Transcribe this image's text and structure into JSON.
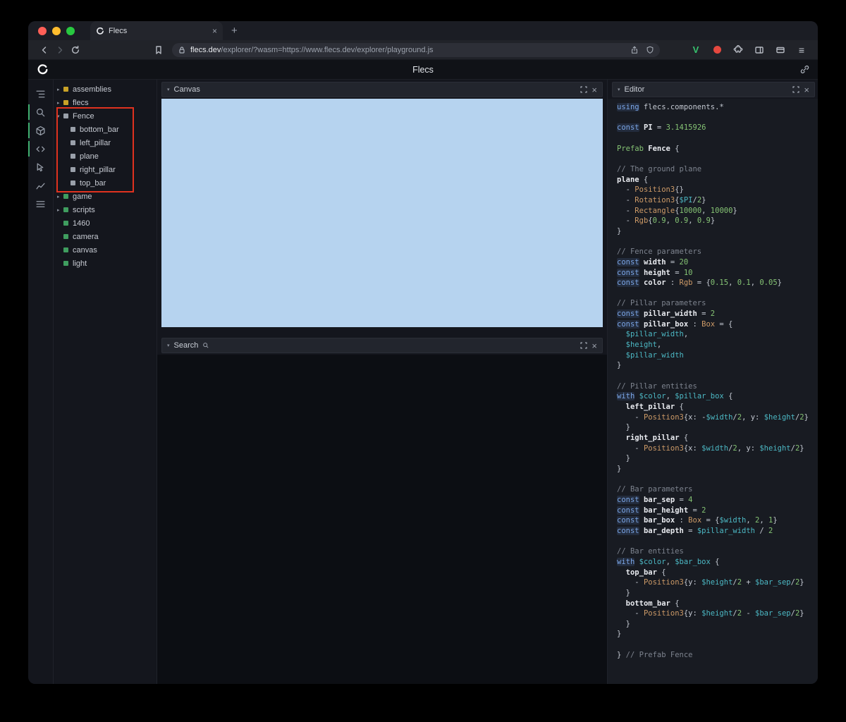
{
  "glyphs": {
    "close": "×",
    "chevron_down": "▾",
    "chevron_right": "▸",
    "new_tab": "+",
    "menu": "≡",
    "v_badge": "V"
  },
  "browser": {
    "tab_title": "Flecs",
    "url_host": "flecs.dev",
    "url_rest": "/explorer/?wasm=https://www.flecs.dev/explorer/playground.js"
  },
  "app": {
    "title": "Flecs"
  },
  "left_toolbar": {
    "items": [
      {
        "icon": "outline-icon",
        "active": false
      },
      {
        "icon": "search-icon",
        "active": true
      },
      {
        "icon": "cube-icon",
        "active": true
      },
      {
        "icon": "code-icon",
        "active": true
      },
      {
        "icon": "select-icon",
        "active": false
      },
      {
        "icon": "chart-icon",
        "active": false
      },
      {
        "icon": "stats-icon",
        "active": false
      }
    ]
  },
  "tree": {
    "items": [
      {
        "label": "assemblies",
        "square": "yellow",
        "expander": "collapsed",
        "depth": 0
      },
      {
        "label": "flecs",
        "square": "yellow",
        "expander": "collapsed",
        "depth": 0
      },
      {
        "label": "Fence",
        "square": "gray",
        "expander": "expanded",
        "depth": 0
      },
      {
        "label": "bottom_bar",
        "square": "gray",
        "expander": "none",
        "depth": 1
      },
      {
        "label": "left_pillar",
        "square": "gray",
        "expander": "none",
        "depth": 1
      },
      {
        "label": "plane",
        "square": "gray",
        "expander": "none",
        "depth": 1
      },
      {
        "label": "right_pillar",
        "square": "gray",
        "expander": "none",
        "depth": 1
      },
      {
        "label": "top_bar",
        "square": "gray",
        "expander": "none",
        "depth": 1
      },
      {
        "label": "game",
        "square": "green",
        "expander": "collapsed",
        "depth": 0
      },
      {
        "label": "scripts",
        "square": "green",
        "expander": "collapsed",
        "depth": 0
      },
      {
        "label": "1460",
        "square": "green",
        "expander": "none",
        "depth": 0
      },
      {
        "label": "camera",
        "square": "green",
        "expander": "none",
        "depth": 0
      },
      {
        "label": "canvas",
        "square": "green",
        "expander": "none",
        "depth": 0
      },
      {
        "label": "light",
        "square": "green",
        "expander": "none",
        "depth": 0
      }
    ]
  },
  "panels": {
    "canvas": {
      "title": "Canvas"
    },
    "search": {
      "title": "Search"
    },
    "editor": {
      "title": "Editor"
    }
  },
  "colors": {
    "canvas_blue": "#b6d3ef",
    "accent_green": "#3fae6f",
    "annotation_red": "#e0321f",
    "square_yellow": "#c9a227",
    "square_green": "#3f9d5f",
    "square_gray": "#9aa0aa"
  },
  "code": {
    "lines": [
      [
        [
          "using",
          "kw"
        ],
        [
          " flecs.components.*",
          "pl"
        ]
      ],
      [],
      [
        [
          "const",
          "kw"
        ],
        [
          " ",
          "pl"
        ],
        [
          "PI",
          "id"
        ],
        [
          " = ",
          "pl"
        ],
        [
          "3.1415926",
          "num"
        ]
      ],
      [],
      [
        [
          "Prefab",
          "green"
        ],
        [
          " ",
          "pl"
        ],
        [
          "Fence",
          "id"
        ],
        [
          " {",
          "pl"
        ]
      ],
      [],
      [
        [
          "// The ground plane",
          "cm"
        ]
      ],
      [
        [
          "plane",
          "id"
        ],
        [
          " {",
          "pl"
        ]
      ],
      [
        [
          "  - ",
          "pl"
        ],
        [
          "Position3",
          "ty"
        ],
        [
          "{}",
          "pl"
        ]
      ],
      [
        [
          "  - ",
          "pl"
        ],
        [
          "Rotation3",
          "ty"
        ],
        [
          "{",
          "pl"
        ],
        [
          "$PI",
          "var"
        ],
        [
          "/",
          "pl"
        ],
        [
          "2",
          "num"
        ],
        [
          "}",
          "pl"
        ]
      ],
      [
        [
          "  - ",
          "pl"
        ],
        [
          "Rectangle",
          "ty"
        ],
        [
          "{",
          "pl"
        ],
        [
          "10000",
          "num"
        ],
        [
          ", ",
          "pl"
        ],
        [
          "10000",
          "num"
        ],
        [
          "}",
          "pl"
        ]
      ],
      [
        [
          "  - ",
          "pl"
        ],
        [
          "Rgb",
          "ty"
        ],
        [
          "{",
          "pl"
        ],
        [
          "0.9",
          "num"
        ],
        [
          ", ",
          "pl"
        ],
        [
          "0.9",
          "num"
        ],
        [
          ", ",
          "pl"
        ],
        [
          "0.9",
          "num"
        ],
        [
          "}",
          "pl"
        ]
      ],
      [
        [
          "}",
          "pl"
        ]
      ],
      [],
      [
        [
          "// Fence parameters",
          "cm"
        ]
      ],
      [
        [
          "const",
          "kw"
        ],
        [
          " ",
          "pl"
        ],
        [
          "width",
          "id"
        ],
        [
          " = ",
          "pl"
        ],
        [
          "20",
          "num"
        ]
      ],
      [
        [
          "const",
          "kw"
        ],
        [
          " ",
          "pl"
        ],
        [
          "height",
          "id"
        ],
        [
          " = ",
          "pl"
        ],
        [
          "10",
          "num"
        ]
      ],
      [
        [
          "const",
          "kw"
        ],
        [
          " ",
          "pl"
        ],
        [
          "color",
          "id"
        ],
        [
          " : ",
          "pl"
        ],
        [
          "Rgb",
          "ty"
        ],
        [
          " = {",
          "pl"
        ],
        [
          "0.15",
          "num"
        ],
        [
          ", ",
          "pl"
        ],
        [
          "0.1",
          "num"
        ],
        [
          ", ",
          "pl"
        ],
        [
          "0.05",
          "num"
        ],
        [
          "}",
          "pl"
        ]
      ],
      [],
      [
        [
          "// Pillar parameters",
          "cm"
        ]
      ],
      [
        [
          "const",
          "kw"
        ],
        [
          " ",
          "pl"
        ],
        [
          "pillar_width",
          "id"
        ],
        [
          " = ",
          "pl"
        ],
        [
          "2",
          "num"
        ]
      ],
      [
        [
          "const",
          "kw"
        ],
        [
          " ",
          "pl"
        ],
        [
          "pillar_box",
          "id"
        ],
        [
          " : ",
          "pl"
        ],
        [
          "Box",
          "ty"
        ],
        [
          " = {",
          "pl"
        ]
      ],
      [
        [
          "  ",
          "pl"
        ],
        [
          "$pillar_width",
          "var"
        ],
        [
          ",",
          "pl"
        ]
      ],
      [
        [
          "  ",
          "pl"
        ],
        [
          "$height",
          "var"
        ],
        [
          ",",
          "pl"
        ]
      ],
      [
        [
          "  ",
          "pl"
        ],
        [
          "$pillar_width",
          "var"
        ]
      ],
      [
        [
          "}",
          "pl"
        ]
      ],
      [],
      [
        [
          "// Pillar entities",
          "cm"
        ]
      ],
      [
        [
          "with",
          "kw"
        ],
        [
          " ",
          "pl"
        ],
        [
          "$color",
          "var"
        ],
        [
          ", ",
          "pl"
        ],
        [
          "$pillar_box",
          "var"
        ],
        [
          " {",
          "pl"
        ]
      ],
      [
        [
          "  ",
          "pl"
        ],
        [
          "left_pillar",
          "id"
        ],
        [
          " {",
          "pl"
        ]
      ],
      [
        [
          "    - ",
          "pl"
        ],
        [
          "Position3",
          "ty"
        ],
        [
          "{",
          "pl"
        ],
        [
          "x:",
          "pl"
        ],
        [
          " -",
          "pl"
        ],
        [
          "$width",
          "var"
        ],
        [
          "/",
          "pl"
        ],
        [
          "2",
          "num"
        ],
        [
          ", ",
          "pl"
        ],
        [
          "y: ",
          "pl"
        ],
        [
          "$height",
          "var"
        ],
        [
          "/",
          "pl"
        ],
        [
          "2",
          "num"
        ],
        [
          "}",
          "pl"
        ]
      ],
      [
        [
          "  }",
          "pl"
        ]
      ],
      [
        [
          "  ",
          "pl"
        ],
        [
          "right_pillar",
          "id"
        ],
        [
          " {",
          "pl"
        ]
      ],
      [
        [
          "    - ",
          "pl"
        ],
        [
          "Position3",
          "ty"
        ],
        [
          "{",
          "pl"
        ],
        [
          "x: ",
          "pl"
        ],
        [
          "$width",
          "var"
        ],
        [
          "/",
          "pl"
        ],
        [
          "2",
          "num"
        ],
        [
          ", ",
          "pl"
        ],
        [
          "y: ",
          "pl"
        ],
        [
          "$height",
          "var"
        ],
        [
          "/",
          "pl"
        ],
        [
          "2",
          "num"
        ],
        [
          "}",
          "pl"
        ]
      ],
      [
        [
          "  }",
          "pl"
        ]
      ],
      [
        [
          "}",
          "pl"
        ]
      ],
      [],
      [
        [
          "// Bar parameters",
          "cm"
        ]
      ],
      [
        [
          "const",
          "kw"
        ],
        [
          " ",
          "pl"
        ],
        [
          "bar_sep",
          "id"
        ],
        [
          " = ",
          "pl"
        ],
        [
          "4",
          "num"
        ]
      ],
      [
        [
          "const",
          "kw"
        ],
        [
          " ",
          "pl"
        ],
        [
          "bar_height",
          "id"
        ],
        [
          " = ",
          "pl"
        ],
        [
          "2",
          "num"
        ]
      ],
      [
        [
          "const",
          "kw"
        ],
        [
          " ",
          "pl"
        ],
        [
          "bar_box",
          "id"
        ],
        [
          " : ",
          "pl"
        ],
        [
          "Box",
          "ty"
        ],
        [
          " = {",
          "pl"
        ],
        [
          "$width",
          "var"
        ],
        [
          ", ",
          "pl"
        ],
        [
          "2",
          "num"
        ],
        [
          ", ",
          "pl"
        ],
        [
          "1",
          "num"
        ],
        [
          "}",
          "pl"
        ]
      ],
      [
        [
          "const",
          "kw"
        ],
        [
          " ",
          "pl"
        ],
        [
          "bar_depth",
          "id"
        ],
        [
          " = ",
          "pl"
        ],
        [
          "$pillar_width",
          "var"
        ],
        [
          " / ",
          "pl"
        ],
        [
          "2",
          "num"
        ]
      ],
      [],
      [
        [
          "// Bar entities",
          "cm"
        ]
      ],
      [
        [
          "with",
          "kw"
        ],
        [
          " ",
          "pl"
        ],
        [
          "$color",
          "var"
        ],
        [
          ", ",
          "pl"
        ],
        [
          "$bar_box",
          "var"
        ],
        [
          " {",
          "pl"
        ]
      ],
      [
        [
          "  ",
          "pl"
        ],
        [
          "top_bar",
          "id"
        ],
        [
          " {",
          "pl"
        ]
      ],
      [
        [
          "    - ",
          "pl"
        ],
        [
          "Position3",
          "ty"
        ],
        [
          "{",
          "pl"
        ],
        [
          "y: ",
          "pl"
        ],
        [
          "$height",
          "var"
        ],
        [
          "/",
          "pl"
        ],
        [
          "2",
          "num"
        ],
        [
          " + ",
          "pl"
        ],
        [
          "$bar_sep",
          "var"
        ],
        [
          "/",
          "pl"
        ],
        [
          "2",
          "num"
        ],
        [
          "}",
          "pl"
        ]
      ],
      [
        [
          "  }",
          "pl"
        ]
      ],
      [
        [
          "  ",
          "pl"
        ],
        [
          "bottom_bar",
          "id"
        ],
        [
          " {",
          "pl"
        ]
      ],
      [
        [
          "    - ",
          "pl"
        ],
        [
          "Position3",
          "ty"
        ],
        [
          "{",
          "pl"
        ],
        [
          "y: ",
          "pl"
        ],
        [
          "$height",
          "var"
        ],
        [
          "/",
          "pl"
        ],
        [
          "2",
          "num"
        ],
        [
          " - ",
          "pl"
        ],
        [
          "$bar_sep",
          "var"
        ],
        [
          "/",
          "pl"
        ],
        [
          "2",
          "num"
        ],
        [
          "}",
          "pl"
        ]
      ],
      [
        [
          "  }",
          "pl"
        ]
      ],
      [
        [
          "}",
          "pl"
        ]
      ],
      [],
      [
        [
          "} ",
          "pl"
        ],
        [
          "// Prefab Fence",
          "cm"
        ]
      ]
    ]
  }
}
